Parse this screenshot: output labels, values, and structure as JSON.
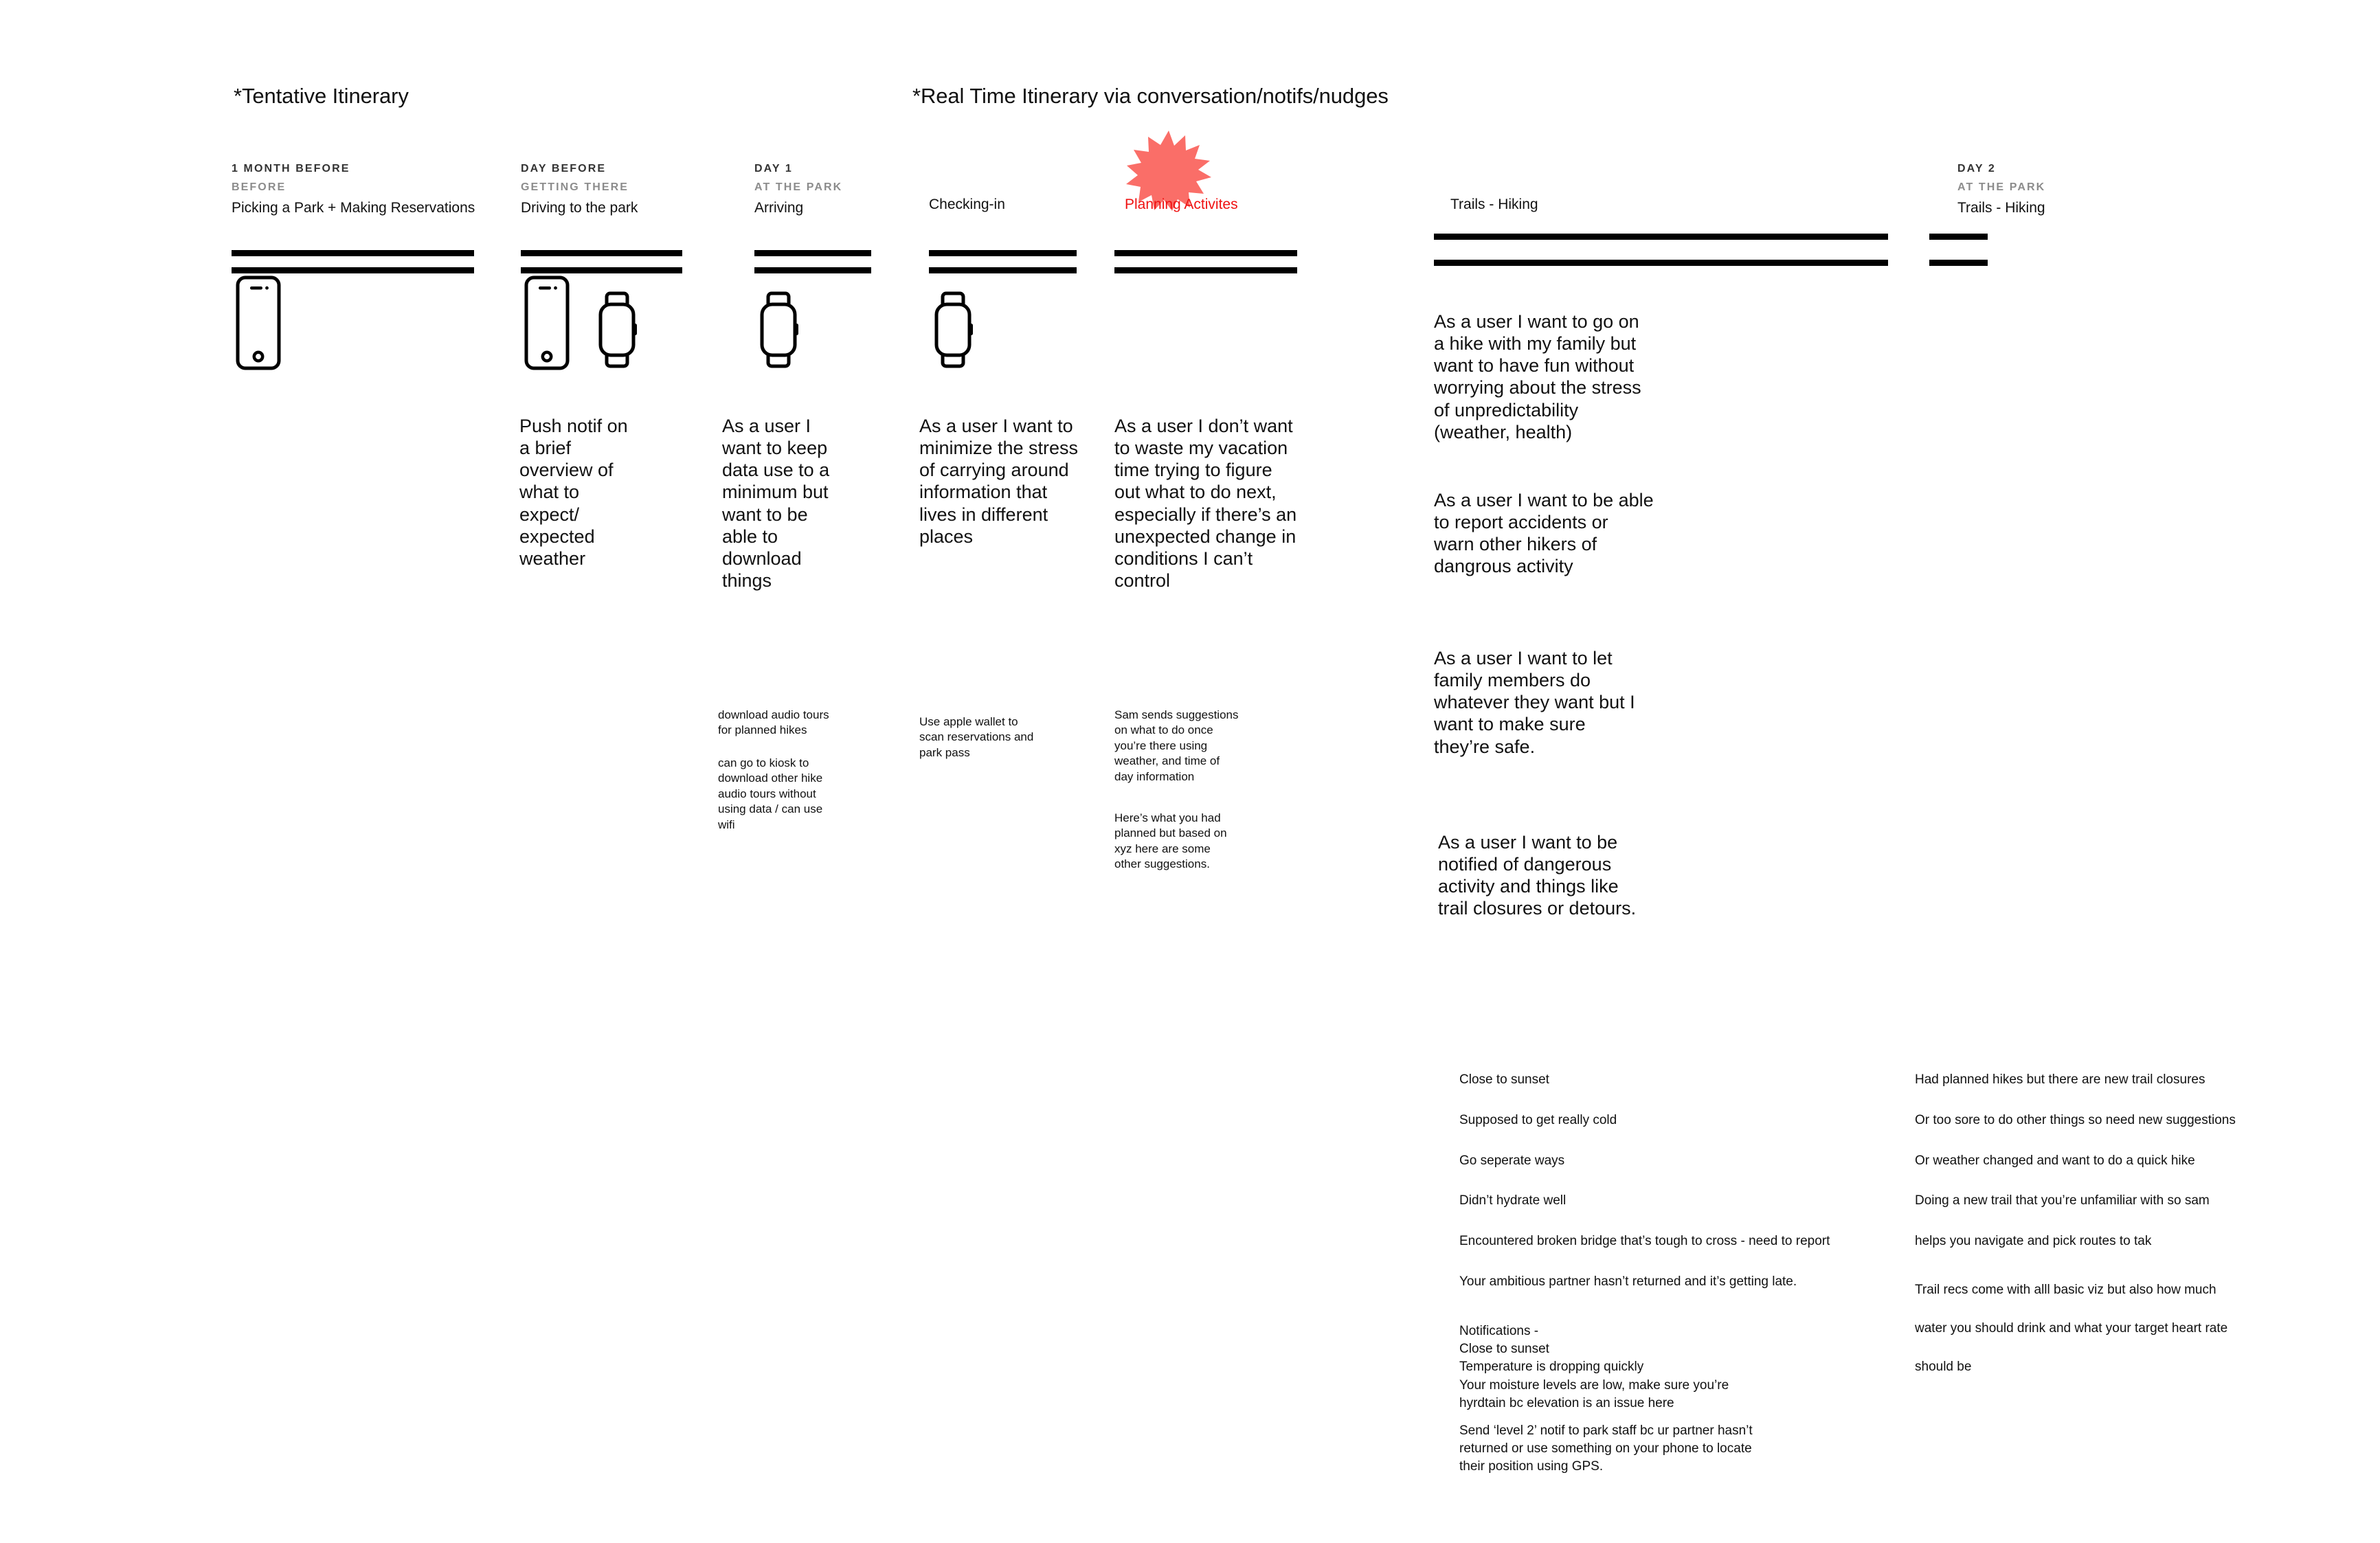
{
  "titles": {
    "tentative": "*Tentative Itinerary",
    "realtime": "*Real Time Itinerary via conversation/notifs/nudges"
  },
  "colors": {
    "starburst": "#fa6e68",
    "accent_text": "#ef1111",
    "rule": "#000000",
    "kicker": "#333333",
    "sub_kicker": "#8c8c8c"
  },
  "columns": [
    {
      "kicker": "1 MONTH BEFORE",
      "sub": "BEFORE",
      "name": "Picking a Park + Making Reservations",
      "devices": [
        "phone-icon"
      ]
    },
    {
      "kicker": "DAY BEFORE",
      "sub": "GETTING THERE",
      "name": "Driving to the park",
      "devices": [
        "phone-icon",
        "watch-icon"
      ]
    },
    {
      "kicker": "DAY 1",
      "sub": "AT THE PARK",
      "name": "Arriving",
      "devices": [
        "watch-icon"
      ]
    },
    {
      "kicker": "",
      "sub": "",
      "name": "Checking-in",
      "devices": [
        "watch-icon"
      ]
    },
    {
      "kicker": "",
      "sub": "",
      "name": "Planning Activites",
      "devices": []
    },
    {
      "kicker": "",
      "sub": "",
      "name": "Trails - Hiking",
      "devices": []
    },
    {
      "kicker": "DAY 2",
      "sub": "AT THE PARK",
      "name": "Trails - Hiking",
      "devices": []
    }
  ],
  "stories": {
    "day_before": "Push notif on\na brief\noverview of\nwhat to\nexpect/\nexpected\nweather",
    "arriving": "As a user I\nwant to keep\ndata use to a\nminimum but\nwant to be\nable to\ndownload\nthings",
    "checking_in": "As a user I want to\nminimize the stress\nof carrying around\ninformation that\nlives in different\nplaces",
    "planning": "As a user I don’t want\nto waste my vacation\ntime trying to figure\nout what to do next,\nespecially if there’s an\nunexpected change in\nconditions I can’t\ncontrol",
    "trails_1": "As a user I want to go on\na hike with my family but\nwant to have fun without\nworrying about the stress\nof unpredictability\n(weather, health)",
    "trails_2": "As a user I want to be able\nto report accidents or\nwarn other hikers of\ndangrous activity",
    "trails_3": "As a user I want to let\nfamily members do\nwhatever they want but I\nwant to make sure\nthey’re safe.",
    "trails_4": "As a user I want to be\nnotified of dangerous\nactivity and things like\ntrail closures or detours."
  },
  "notes": {
    "arriving_1": "download audio tours\nfor planned hikes",
    "arriving_2": "can go to kiosk to\ndownload other hike\naudio tours without\nusing data / can use\nwifi",
    "checking_in_1": "Use apple wallet to\nscan reservations and\npark pass",
    "planning_1": "Sam sends suggestions\non what to do once\nyou’re there using\nweather, and time of\nday information",
    "planning_2": "Here’s what you had\nplanned but based on\nxyz here are some\nother suggestions."
  },
  "scenarios_left": [
    "Close to sunset",
    "Supposed to get really cold",
    "Go seperate ways",
    "Didn’t hydrate well",
    "Encountered broken bridge that’s tough to cross - need to report",
    "Your ambitious partner hasn’t returned and it’s getting late."
  ],
  "scenarios_right": [
    "Had planned hikes but there are new trail closures",
    "Or too sore to do other things so need new suggestions",
    "Or weather changed and want to do a quick hike",
    "Doing a new trail that you’re unfamiliar with so sam",
    "helps you navigate and pick routes to tak"
  ],
  "trail_recs": [
    "Trail recs come with alll basic viz but also how much",
    "water you should drink and what your target heart rate",
    "should be"
  ],
  "notifications": {
    "block_1": "Notifications -\nClose to sunset\nTemperature is dropping quickly\nYour moisture levels are low, make sure you’re\nhyrdtain bc elevation is an issue here",
    "block_2": "Send ‘level 2’ notif to park staff bc ur partner hasn’t\nreturned or use something on your phone to locate\ntheir position using GPS."
  }
}
